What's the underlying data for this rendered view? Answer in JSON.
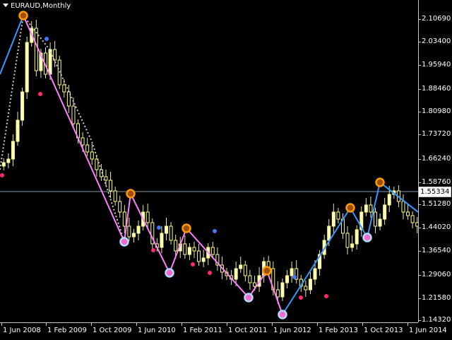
{
  "header": {
    "symbol_timeframe": "EURAUD,Monthly",
    "menu_icon": "triangle-down-icon"
  },
  "y_axis": {
    "labels": [
      "2.10690",
      "2.03400",
      "1.95940",
      "1.88460",
      "1.80980",
      "1.73720",
      "1.66240",
      "1.58760",
      "1.51280",
      "1.44020",
      "1.36540",
      "1.29060",
      "1.21580",
      "1.14320"
    ]
  },
  "x_axis": {
    "labels": [
      "1 Jun 2008",
      "1 Feb 2009",
      "1 Oct 2009",
      "1 Jun 2010",
      "1 Feb 2011",
      "1 Oct 2011",
      "1 Jun 2012",
      "1 Feb 2013",
      "1 Oct 2013",
      "1 Jun 2014"
    ]
  },
  "price_line": {
    "value": 1.55334,
    "label": "1.55334"
  },
  "colors": {
    "background": "#000000",
    "bull_body": "#ffffc0",
    "bear_body": "#ffff80",
    "wick": "#e8e8a0",
    "blue_line": "#3399ff",
    "pink_line": "#ff80ff",
    "marker_orange": "#ff9900",
    "marker_cyan": "#aaddff",
    "marker_pink": "#ff2a6d",
    "marker_blue": "#4477ff"
  },
  "chart_data": {
    "type": "candlestick",
    "symbol": "EURAUD",
    "timeframe": "Monthly",
    "ylim": [
      1.128,
      2.142
    ],
    "x_range": [
      "2008-06",
      "2014-07"
    ],
    "current_price": 1.55334
  }
}
